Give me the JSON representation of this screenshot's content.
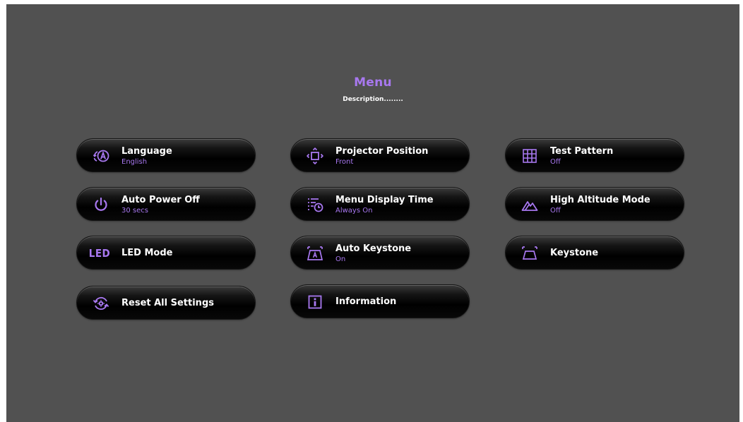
{
  "menu": {
    "title": "Menu",
    "description": "Description........"
  },
  "accent_color": "#a878f0",
  "items": {
    "language": {
      "label": "Language",
      "value": "English",
      "icon": "language-icon"
    },
    "projector_position": {
      "label": "Projector Position",
      "value": "Front",
      "icon": "projector-position-icon"
    },
    "test_pattern": {
      "label": "Test Pattern",
      "value": "Off",
      "icon": "grid-icon"
    },
    "auto_power_off": {
      "label": "Auto Power Off",
      "value": "30 secs",
      "icon": "power-icon"
    },
    "menu_display_time": {
      "label": "Menu Display Time",
      "value": "Always On",
      "icon": "menu-timer-icon"
    },
    "high_altitude_mode": {
      "label": "High Altitude Mode",
      "value": "Off",
      "icon": "mountain-icon"
    },
    "led_mode": {
      "label": "LED Mode",
      "icon": "led-icon",
      "icon_text": "LED"
    },
    "auto_keystone": {
      "label": "Auto Keystone",
      "value": "On",
      "icon": "auto-keystone-icon"
    },
    "keystone": {
      "label": "Keystone",
      "icon": "keystone-icon"
    },
    "reset_all_settings": {
      "label": "Reset All Settings",
      "icon": "reset-icon"
    },
    "information": {
      "label": "Information",
      "icon": "information-icon"
    }
  }
}
